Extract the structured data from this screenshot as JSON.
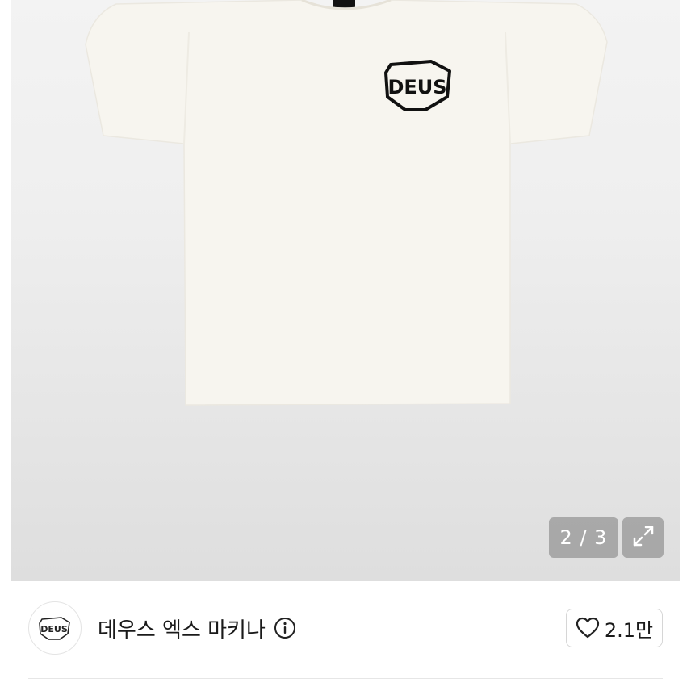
{
  "product_image": {
    "alt": "흰색 반팔 티셔츠",
    "logo_text": "DEUS",
    "counter": "2 / 3"
  },
  "shop": {
    "avatar_text": "DEUS",
    "name": "데우스 엑스 마키나",
    "like_count": "2.1만"
  },
  "colors": {
    "photo_bg": "#ececec",
    "tshirt": "#f7f5ef",
    "overlay": "#969696"
  },
  "icons": {
    "expand": "expand-icon",
    "info": "info-icon",
    "heart": "heart-icon"
  }
}
